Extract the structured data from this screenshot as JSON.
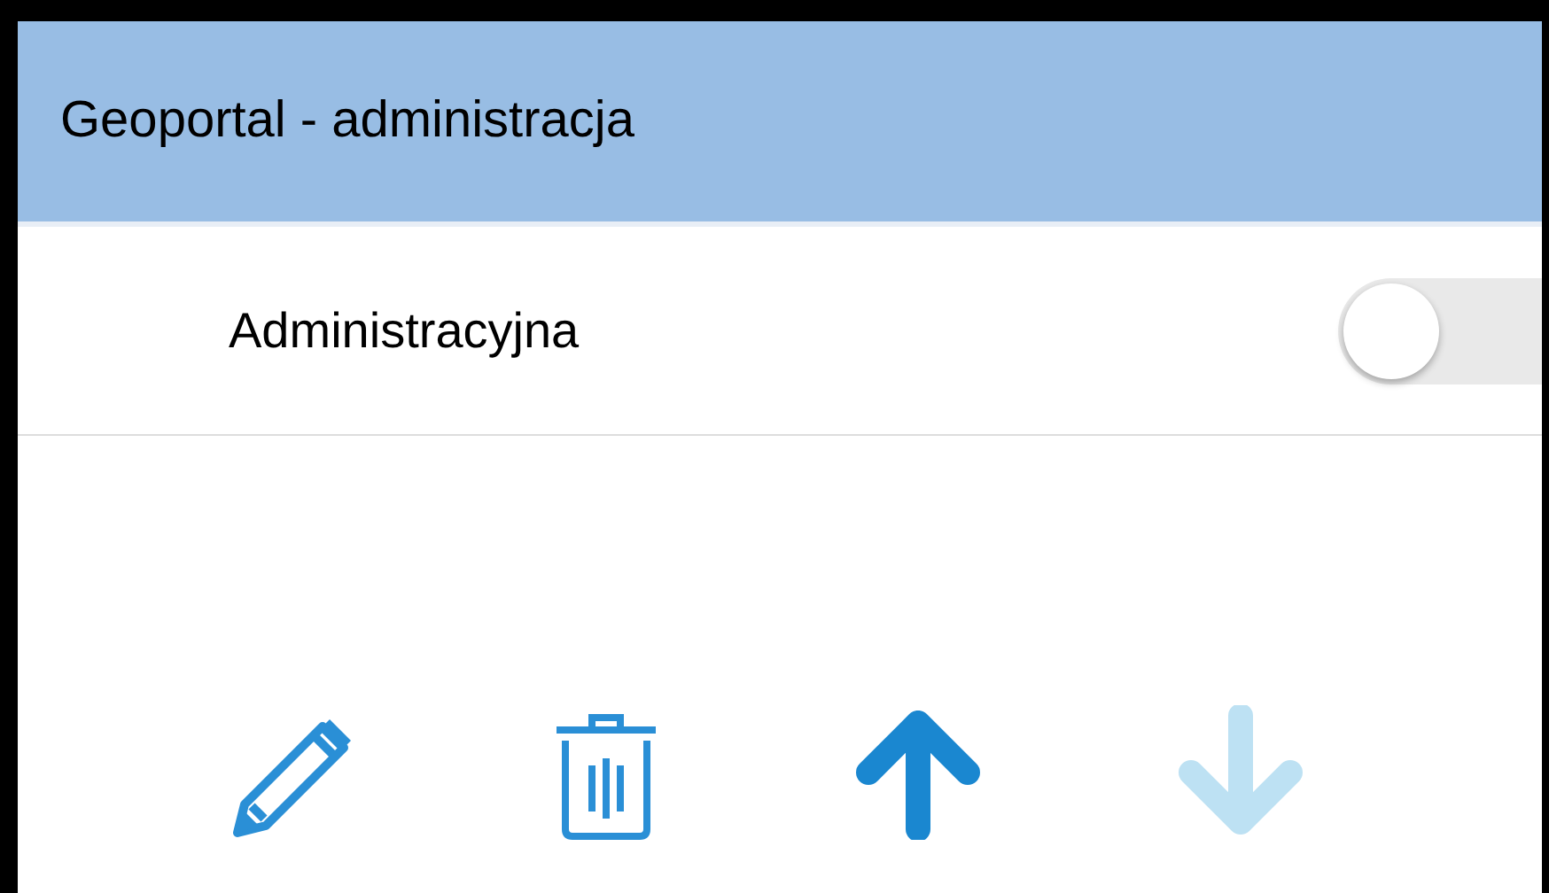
{
  "header": {
    "title": "Geoportal - administracja"
  },
  "layers": [
    {
      "name": "Administracyjna",
      "on": false
    }
  ],
  "actions": [
    {
      "kind": "edit",
      "disabled": false
    },
    {
      "kind": "delete",
      "disabled": false
    },
    {
      "kind": "up",
      "disabled": false
    },
    {
      "kind": "down",
      "disabled": true
    }
  ]
}
